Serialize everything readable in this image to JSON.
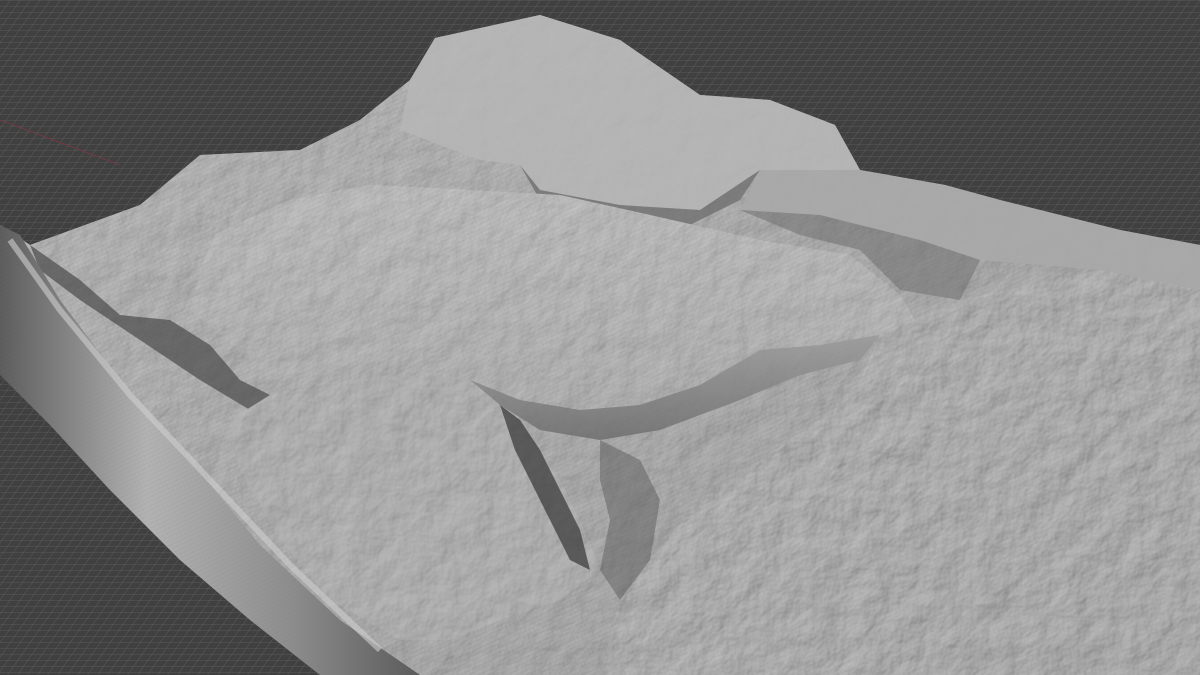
{
  "viewport": {
    "background_color": "#404040",
    "grid_color": "#9a9a9a",
    "grid_axis_color": "#7a3a44",
    "mesh_fill_color": "#8f8f8f",
    "mesh_highlight_color": "#c9c9c9",
    "mesh_shadow_color": "#3a3a3a",
    "mesh_wireframe_color": "#6e6e6e"
  },
  "scene": {
    "object": "terrain-heightfield-mesh",
    "features": [
      "plateau",
      "central-mesa",
      "canyon-cliff",
      "rolled-mesh-edge"
    ],
    "grid_visible": true
  }
}
